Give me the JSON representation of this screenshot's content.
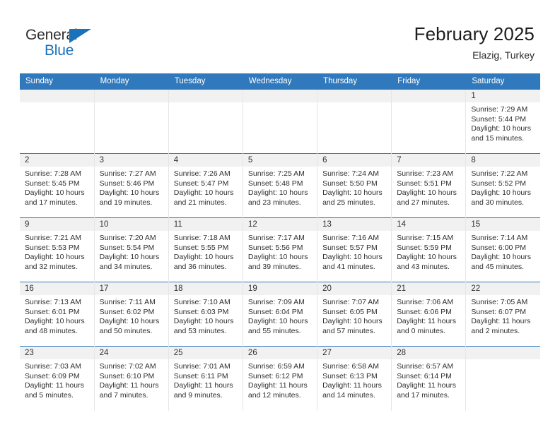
{
  "brand": {
    "name_part1": "General",
    "name_part2": "Blue",
    "triangle_icon": "triangle-icon",
    "color_dark": "#2e2e2e",
    "color_blue": "#1a72bb"
  },
  "header": {
    "title": "February 2025",
    "location": "Elazig, Turkey"
  },
  "theme": {
    "header_bg": "#3179bd",
    "daynum_band_bg": "#f1f1f1",
    "row_divider": "#3179bd",
    "col_divider": "#e6e6e6",
    "text": "#2f2f2f"
  },
  "weekdays": [
    "Sunday",
    "Monday",
    "Tuesday",
    "Wednesday",
    "Thursday",
    "Friday",
    "Saturday"
  ],
  "weeks": [
    [
      {
        "blank": true,
        "day": ""
      },
      {
        "blank": true,
        "day": ""
      },
      {
        "blank": true,
        "day": ""
      },
      {
        "blank": true,
        "day": ""
      },
      {
        "blank": true,
        "day": ""
      },
      {
        "blank": true,
        "day": ""
      },
      {
        "blank": false,
        "day": "1",
        "sunrise": "Sunrise: 7:29 AM",
        "sunset": "Sunset: 5:44 PM",
        "daylight1": "Daylight: 10 hours",
        "daylight2": "and 15 minutes."
      }
    ],
    [
      {
        "blank": false,
        "day": "2",
        "sunrise": "Sunrise: 7:28 AM",
        "sunset": "Sunset: 5:45 PM",
        "daylight1": "Daylight: 10 hours",
        "daylight2": "and 17 minutes."
      },
      {
        "blank": false,
        "day": "3",
        "sunrise": "Sunrise: 7:27 AM",
        "sunset": "Sunset: 5:46 PM",
        "daylight1": "Daylight: 10 hours",
        "daylight2": "and 19 minutes."
      },
      {
        "blank": false,
        "day": "4",
        "sunrise": "Sunrise: 7:26 AM",
        "sunset": "Sunset: 5:47 PM",
        "daylight1": "Daylight: 10 hours",
        "daylight2": "and 21 minutes."
      },
      {
        "blank": false,
        "day": "5",
        "sunrise": "Sunrise: 7:25 AM",
        "sunset": "Sunset: 5:48 PM",
        "daylight1": "Daylight: 10 hours",
        "daylight2": "and 23 minutes."
      },
      {
        "blank": false,
        "day": "6",
        "sunrise": "Sunrise: 7:24 AM",
        "sunset": "Sunset: 5:50 PM",
        "daylight1": "Daylight: 10 hours",
        "daylight2": "and 25 minutes."
      },
      {
        "blank": false,
        "day": "7",
        "sunrise": "Sunrise: 7:23 AM",
        "sunset": "Sunset: 5:51 PM",
        "daylight1": "Daylight: 10 hours",
        "daylight2": "and 27 minutes."
      },
      {
        "blank": false,
        "day": "8",
        "sunrise": "Sunrise: 7:22 AM",
        "sunset": "Sunset: 5:52 PM",
        "daylight1": "Daylight: 10 hours",
        "daylight2": "and 30 minutes."
      }
    ],
    [
      {
        "blank": false,
        "day": "9",
        "sunrise": "Sunrise: 7:21 AM",
        "sunset": "Sunset: 5:53 PM",
        "daylight1": "Daylight: 10 hours",
        "daylight2": "and 32 minutes."
      },
      {
        "blank": false,
        "day": "10",
        "sunrise": "Sunrise: 7:20 AM",
        "sunset": "Sunset: 5:54 PM",
        "daylight1": "Daylight: 10 hours",
        "daylight2": "and 34 minutes."
      },
      {
        "blank": false,
        "day": "11",
        "sunrise": "Sunrise: 7:18 AM",
        "sunset": "Sunset: 5:55 PM",
        "daylight1": "Daylight: 10 hours",
        "daylight2": "and 36 minutes."
      },
      {
        "blank": false,
        "day": "12",
        "sunrise": "Sunrise: 7:17 AM",
        "sunset": "Sunset: 5:56 PM",
        "daylight1": "Daylight: 10 hours",
        "daylight2": "and 39 minutes."
      },
      {
        "blank": false,
        "day": "13",
        "sunrise": "Sunrise: 7:16 AM",
        "sunset": "Sunset: 5:57 PM",
        "daylight1": "Daylight: 10 hours",
        "daylight2": "and 41 minutes."
      },
      {
        "blank": false,
        "day": "14",
        "sunrise": "Sunrise: 7:15 AM",
        "sunset": "Sunset: 5:59 PM",
        "daylight1": "Daylight: 10 hours",
        "daylight2": "and 43 minutes."
      },
      {
        "blank": false,
        "day": "15",
        "sunrise": "Sunrise: 7:14 AM",
        "sunset": "Sunset: 6:00 PM",
        "daylight1": "Daylight: 10 hours",
        "daylight2": "and 45 minutes."
      }
    ],
    [
      {
        "blank": false,
        "day": "16",
        "sunrise": "Sunrise: 7:13 AM",
        "sunset": "Sunset: 6:01 PM",
        "daylight1": "Daylight: 10 hours",
        "daylight2": "and 48 minutes."
      },
      {
        "blank": false,
        "day": "17",
        "sunrise": "Sunrise: 7:11 AM",
        "sunset": "Sunset: 6:02 PM",
        "daylight1": "Daylight: 10 hours",
        "daylight2": "and 50 minutes."
      },
      {
        "blank": false,
        "day": "18",
        "sunrise": "Sunrise: 7:10 AM",
        "sunset": "Sunset: 6:03 PM",
        "daylight1": "Daylight: 10 hours",
        "daylight2": "and 53 minutes."
      },
      {
        "blank": false,
        "day": "19",
        "sunrise": "Sunrise: 7:09 AM",
        "sunset": "Sunset: 6:04 PM",
        "daylight1": "Daylight: 10 hours",
        "daylight2": "and 55 minutes."
      },
      {
        "blank": false,
        "day": "20",
        "sunrise": "Sunrise: 7:07 AM",
        "sunset": "Sunset: 6:05 PM",
        "daylight1": "Daylight: 10 hours",
        "daylight2": "and 57 minutes."
      },
      {
        "blank": false,
        "day": "21",
        "sunrise": "Sunrise: 7:06 AM",
        "sunset": "Sunset: 6:06 PM",
        "daylight1": "Daylight: 11 hours",
        "daylight2": "and 0 minutes."
      },
      {
        "blank": false,
        "day": "22",
        "sunrise": "Sunrise: 7:05 AM",
        "sunset": "Sunset: 6:07 PM",
        "daylight1": "Daylight: 11 hours",
        "daylight2": "and 2 minutes."
      }
    ],
    [
      {
        "blank": false,
        "day": "23",
        "sunrise": "Sunrise: 7:03 AM",
        "sunset": "Sunset: 6:09 PM",
        "daylight1": "Daylight: 11 hours",
        "daylight2": "and 5 minutes."
      },
      {
        "blank": false,
        "day": "24",
        "sunrise": "Sunrise: 7:02 AM",
        "sunset": "Sunset: 6:10 PM",
        "daylight1": "Daylight: 11 hours",
        "daylight2": "and 7 minutes."
      },
      {
        "blank": false,
        "day": "25",
        "sunrise": "Sunrise: 7:01 AM",
        "sunset": "Sunset: 6:11 PM",
        "daylight1": "Daylight: 11 hours",
        "daylight2": "and 9 minutes."
      },
      {
        "blank": false,
        "day": "26",
        "sunrise": "Sunrise: 6:59 AM",
        "sunset": "Sunset: 6:12 PM",
        "daylight1": "Daylight: 11 hours",
        "daylight2": "and 12 minutes."
      },
      {
        "blank": false,
        "day": "27",
        "sunrise": "Sunrise: 6:58 AM",
        "sunset": "Sunset: 6:13 PM",
        "daylight1": "Daylight: 11 hours",
        "daylight2": "and 14 minutes."
      },
      {
        "blank": false,
        "day": "28",
        "sunrise": "Sunrise: 6:57 AM",
        "sunset": "Sunset: 6:14 PM",
        "daylight1": "Daylight: 11 hours",
        "daylight2": "and 17 minutes."
      },
      {
        "blank": true,
        "day": ""
      }
    ]
  ]
}
